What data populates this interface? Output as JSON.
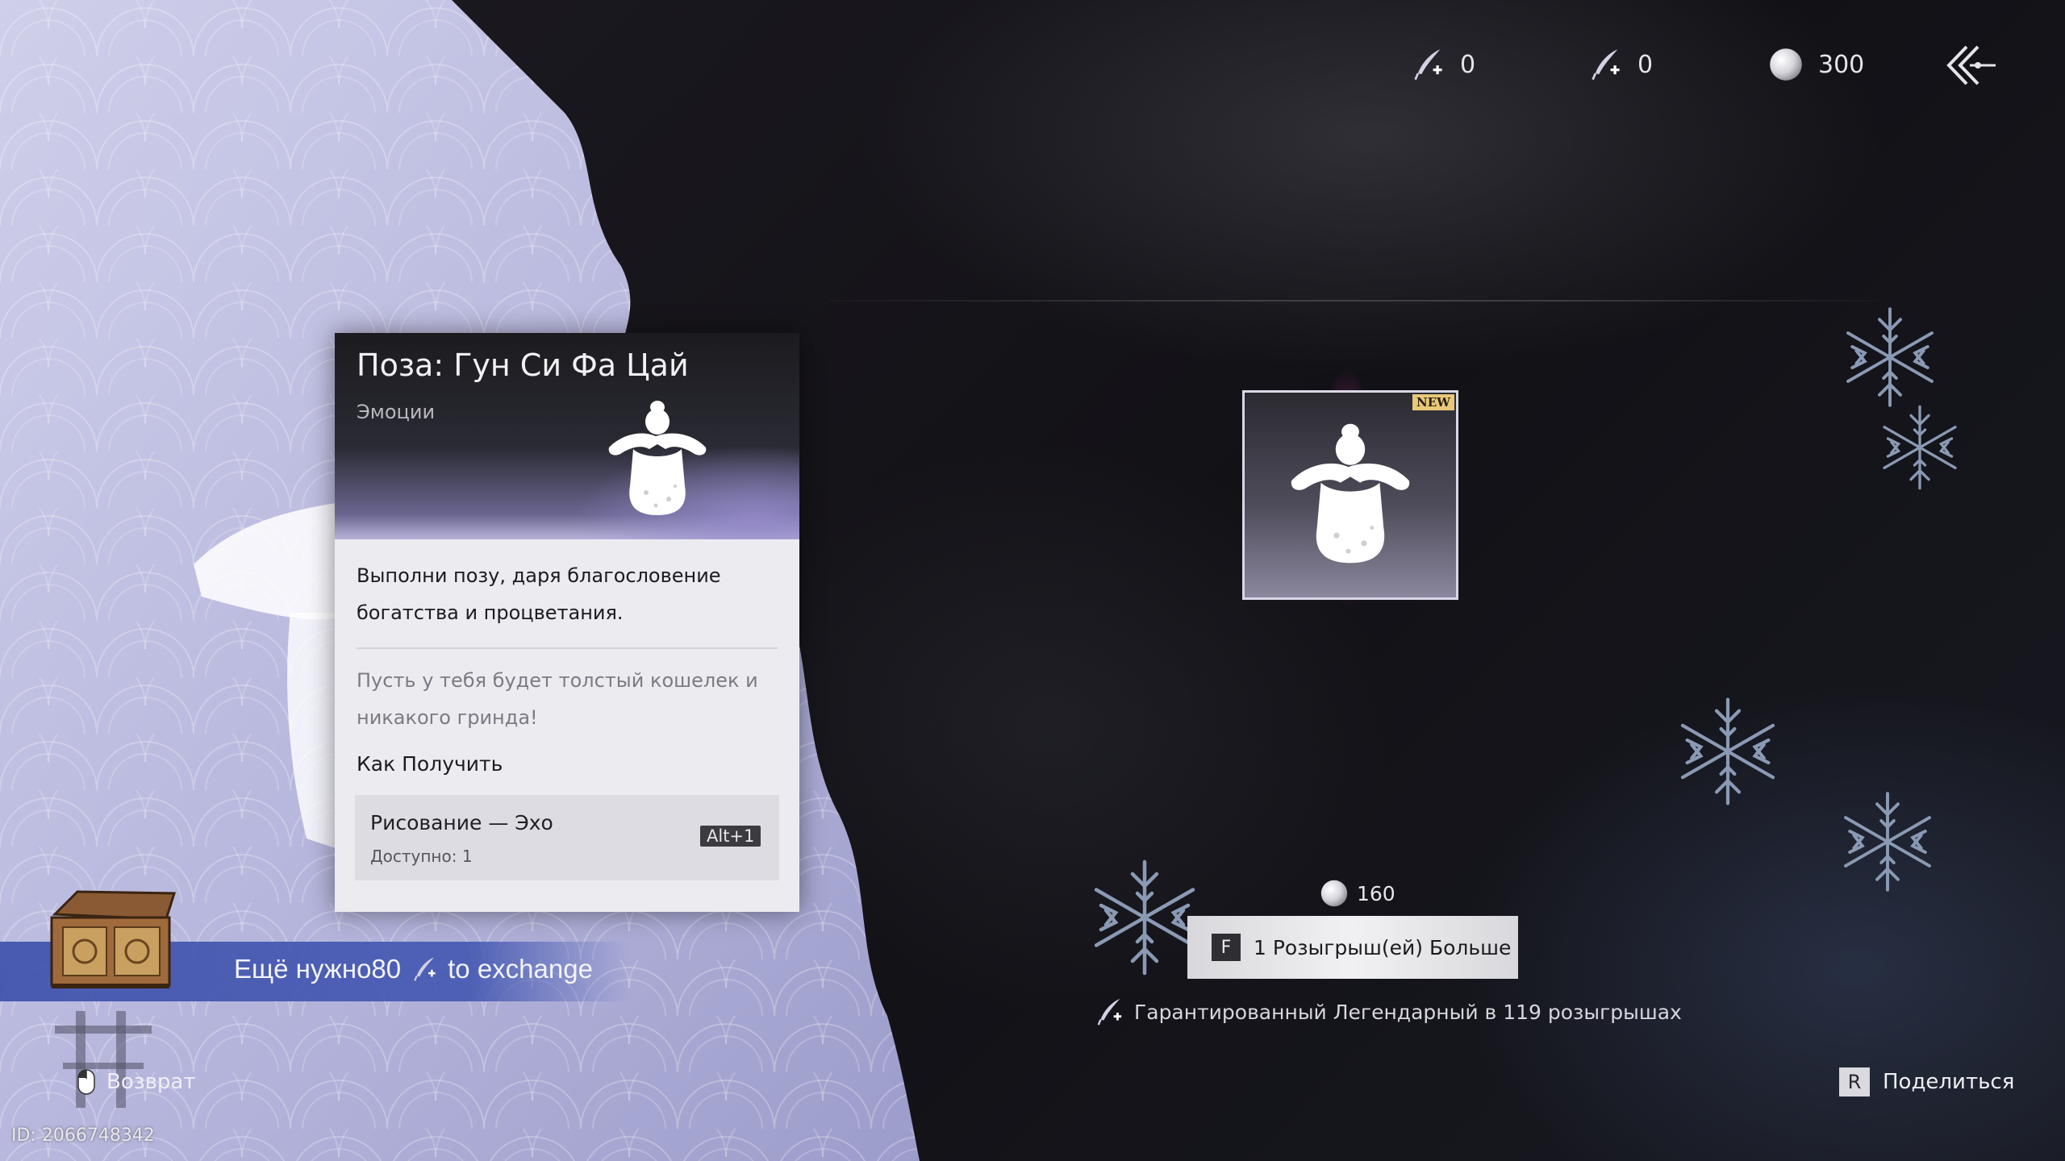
{
  "top_bar": {
    "currencies": [
      {
        "icon": "quill-plus-icon",
        "value": "0"
      },
      {
        "icon": "quill-plus-blue-icon",
        "value": "0"
      },
      {
        "icon": "pearl-icon",
        "value": "300"
      }
    ],
    "back_icon": "double-chevron-left-icon"
  },
  "item_card": {
    "title": "Поза: Гун Си Фа Цай",
    "category": "Эмоции",
    "description": "Выполни позу, даря благословение богатства и процветания.",
    "flavor": "Пусть у тебя будет толстый кошелек и никакого гринда!",
    "how_to_get_label": "Как Получить",
    "source": {
      "name": "Рисование — Эхо",
      "available": "Доступно: 1",
      "hotkey": "Alt+1"
    }
  },
  "featured_item": {
    "badge": "NEW",
    "icon": "pose-figure-icon"
  },
  "draw": {
    "cost": "160",
    "cost_icon": "pearl-icon",
    "key": "F",
    "button_label": "1 Розыгрыш(ей) Больше",
    "guarantee_text": "Гарантированный Легендарный в 119 розыгрышах"
  },
  "exchange_banner": {
    "prefix": "Ещё нужно80",
    "suffix": "to exchange"
  },
  "bottom": {
    "back_label": "Возврат",
    "share_key": "R",
    "share_label": "Поделиться",
    "uid": "ID: 2066748342"
  },
  "colors": {
    "accent_pink": "#d228aa",
    "banner_blue": "#4458b2",
    "new_badge": "#e8c979",
    "card_bg": "#ececf0"
  }
}
